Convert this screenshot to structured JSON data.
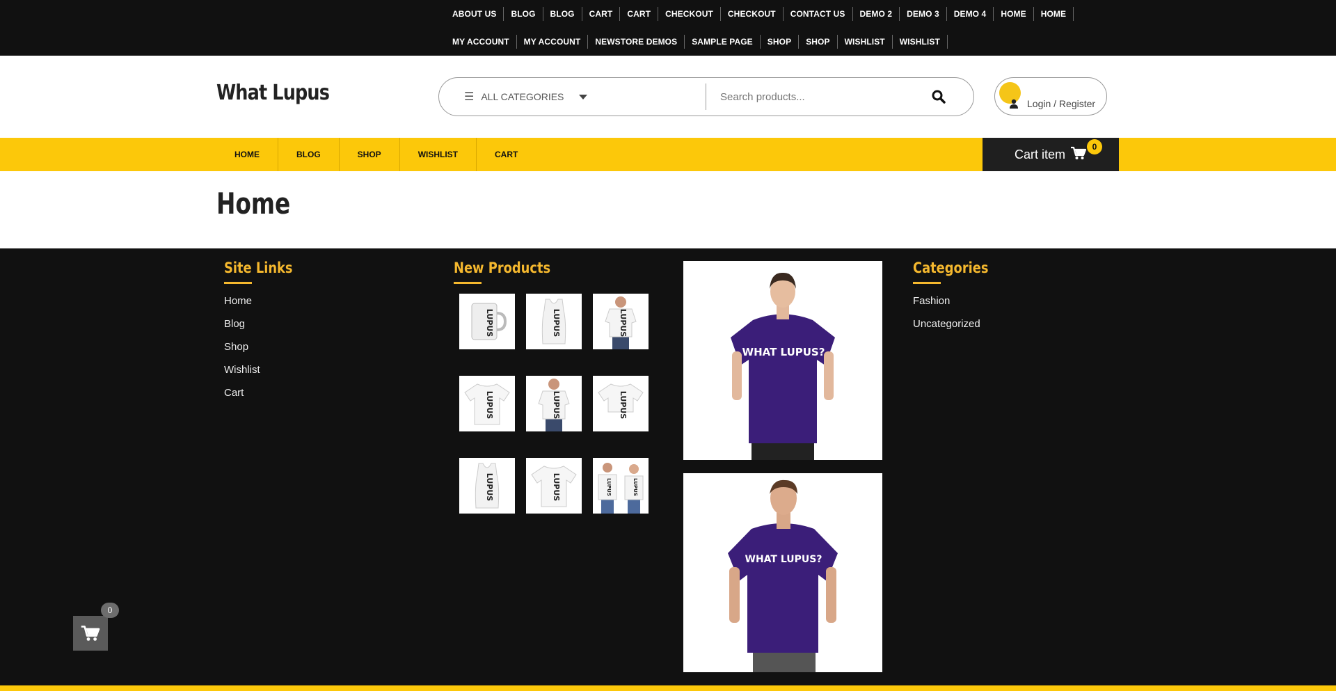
{
  "top_menu": [
    "ABOUT US",
    "BLOG",
    "BLOG",
    "CART",
    "CART",
    "CHECKOUT",
    "CHECKOUT",
    "CONTACT US",
    "DEMO 2",
    "DEMO 3",
    "DEMO 4",
    "HOME",
    "HOME",
    "MY ACCOUNT",
    "MY ACCOUNT",
    "NEWSTORE DEMOS",
    "SAMPLE PAGE",
    "SHOP",
    "SHOP",
    "WISHLIST",
    "WISHLIST"
  ],
  "site": {
    "title": "What Lupus"
  },
  "search": {
    "category_label": "ALL CATEGORIES",
    "placeholder": "Search products..."
  },
  "account": {
    "login_label": "Login / Register"
  },
  "main_menu": [
    "HOME",
    "BLOG",
    "SHOP",
    "WISHLIST",
    "CART"
  ],
  "cart": {
    "label": "Cart item",
    "count": "0"
  },
  "page": {
    "title": "Home"
  },
  "footer": {
    "site_links": {
      "heading": "Site Links",
      "items": [
        "Home",
        "Blog",
        "Shop",
        "Wishlist",
        "Cart"
      ]
    },
    "new_products": {
      "heading": "New Products"
    },
    "categories": {
      "heading": "Categories",
      "items": [
        "Fashion",
        "Uncategorized"
      ]
    }
  },
  "products": {
    "thumbnails": [
      {
        "kind": "mug",
        "text": "LUPUS"
      },
      {
        "kind": "tank",
        "text": "LUPUS"
      },
      {
        "kind": "person",
        "text": "LUPUS"
      },
      {
        "kind": "tee",
        "text": "LUPUS"
      },
      {
        "kind": "person",
        "text": "LUPUS"
      },
      {
        "kind": "crop",
        "text": "LUPUS"
      },
      {
        "kind": "tank",
        "text": "LUPUS"
      },
      {
        "kind": "tee",
        "text": "LUPUS"
      },
      {
        "kind": "couple",
        "text": "LUPUS"
      }
    ],
    "featured": [
      {
        "shirt_text": "WHAT LUPUS?",
        "shirt_color": "#3b1e79"
      },
      {
        "shirt_text": "WHAT LUPUS?",
        "shirt_color": "#3b1e79"
      }
    ]
  },
  "floating_cart": {
    "count": "0"
  },
  "colors": {
    "accent": "#fcc80a",
    "dark": "#111111",
    "heading": "#f5b82e"
  }
}
